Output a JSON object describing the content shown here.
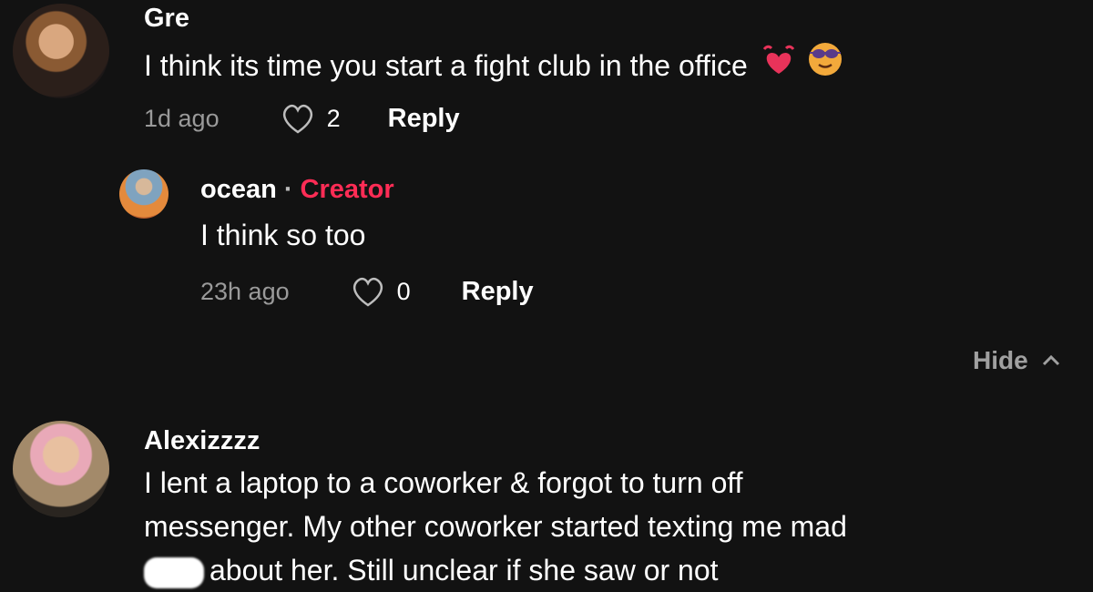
{
  "comments": [
    {
      "username": "Gre",
      "text": "I think its time you start a fight club in the office",
      "emojis": [
        "heart-with-waves-emoji",
        "smiling-face-with-sunglasses-emoji"
      ],
      "time": "1d ago",
      "likes": "2",
      "reply_label": "Reply"
    },
    {
      "username": "ocean",
      "separator": "·",
      "badge": "Creator",
      "text": "I think so too",
      "time": "23h ago",
      "likes": "0",
      "reply_label": "Reply",
      "is_reply": true
    },
    {
      "username": "Alexizzzz",
      "lines": [
        "I lent a laptop to a coworker & forgot to turn off",
        "messenger. My other coworker started texting me mad",
        "about her. Still unclear if she saw or not"
      ],
      "redacted": true
    }
  ],
  "hide_label": "Hide",
  "colors": {
    "background": "#121212",
    "creator": "#fe2c55",
    "muted": "#9a9a9a"
  }
}
